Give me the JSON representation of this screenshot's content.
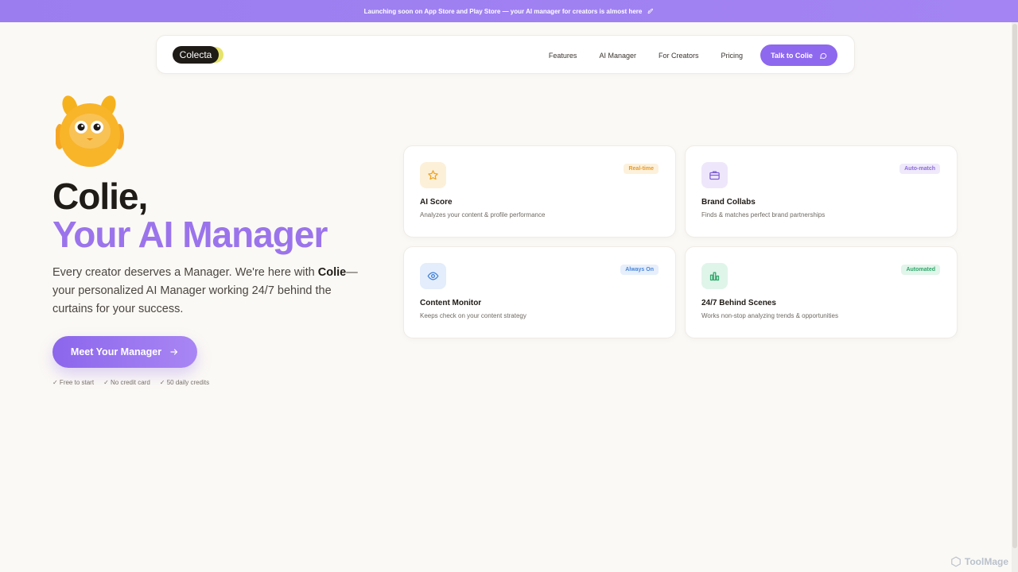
{
  "announcement": {
    "text": "Launching soon on App Store and Play Store — your AI manager for creators is almost here",
    "icon": "rocket-icon"
  },
  "nav": {
    "logo": "Colecta",
    "links": [
      "Features",
      "AI Manager",
      "For Creators",
      "Pricing"
    ],
    "cta": "Talk to Colie"
  },
  "hero": {
    "title_line1": "Colie,",
    "title_line2": "Your AI Manager",
    "desc_pre": "Every creator deserves a Manager. We're here with ",
    "desc_bold": "Colie",
    "desc_post": "—your personalized AI Manager working 24/7 behind the curtains for your success.",
    "cta": "Meet Your Manager",
    "perks": [
      "✓ Free to start",
      "✓ No credit card",
      "✓ 50 daily credits"
    ]
  },
  "cards": [
    {
      "title": "AI Score",
      "subtitle": "Analyzes your content & profile performance",
      "badge": "Real-time",
      "icon": "star-icon"
    },
    {
      "title": "Brand Collabs",
      "subtitle": "Finds & matches perfect brand partnerships",
      "badge": "Auto-match",
      "icon": "briefcase-icon"
    },
    {
      "title": "Content Monitor",
      "subtitle": "Keeps check on your content strategy",
      "badge": "Always On",
      "icon": "eye-icon"
    },
    {
      "title": "24/7 Behind Scenes",
      "subtitle": "Works non-stop analyzing trends & opportunities",
      "badge": "Automated",
      "icon": "bar-chart-icon"
    }
  ],
  "colors": {
    "accent": "#8e68ee",
    "background": "#fbf9f5",
    "badge_realtime": "#f2a33a",
    "badge_automatch": "#8a6bd8",
    "badge_alwayson": "#4a86d6",
    "badge_automated": "#2fa66a"
  },
  "watermark": "ToolMage"
}
